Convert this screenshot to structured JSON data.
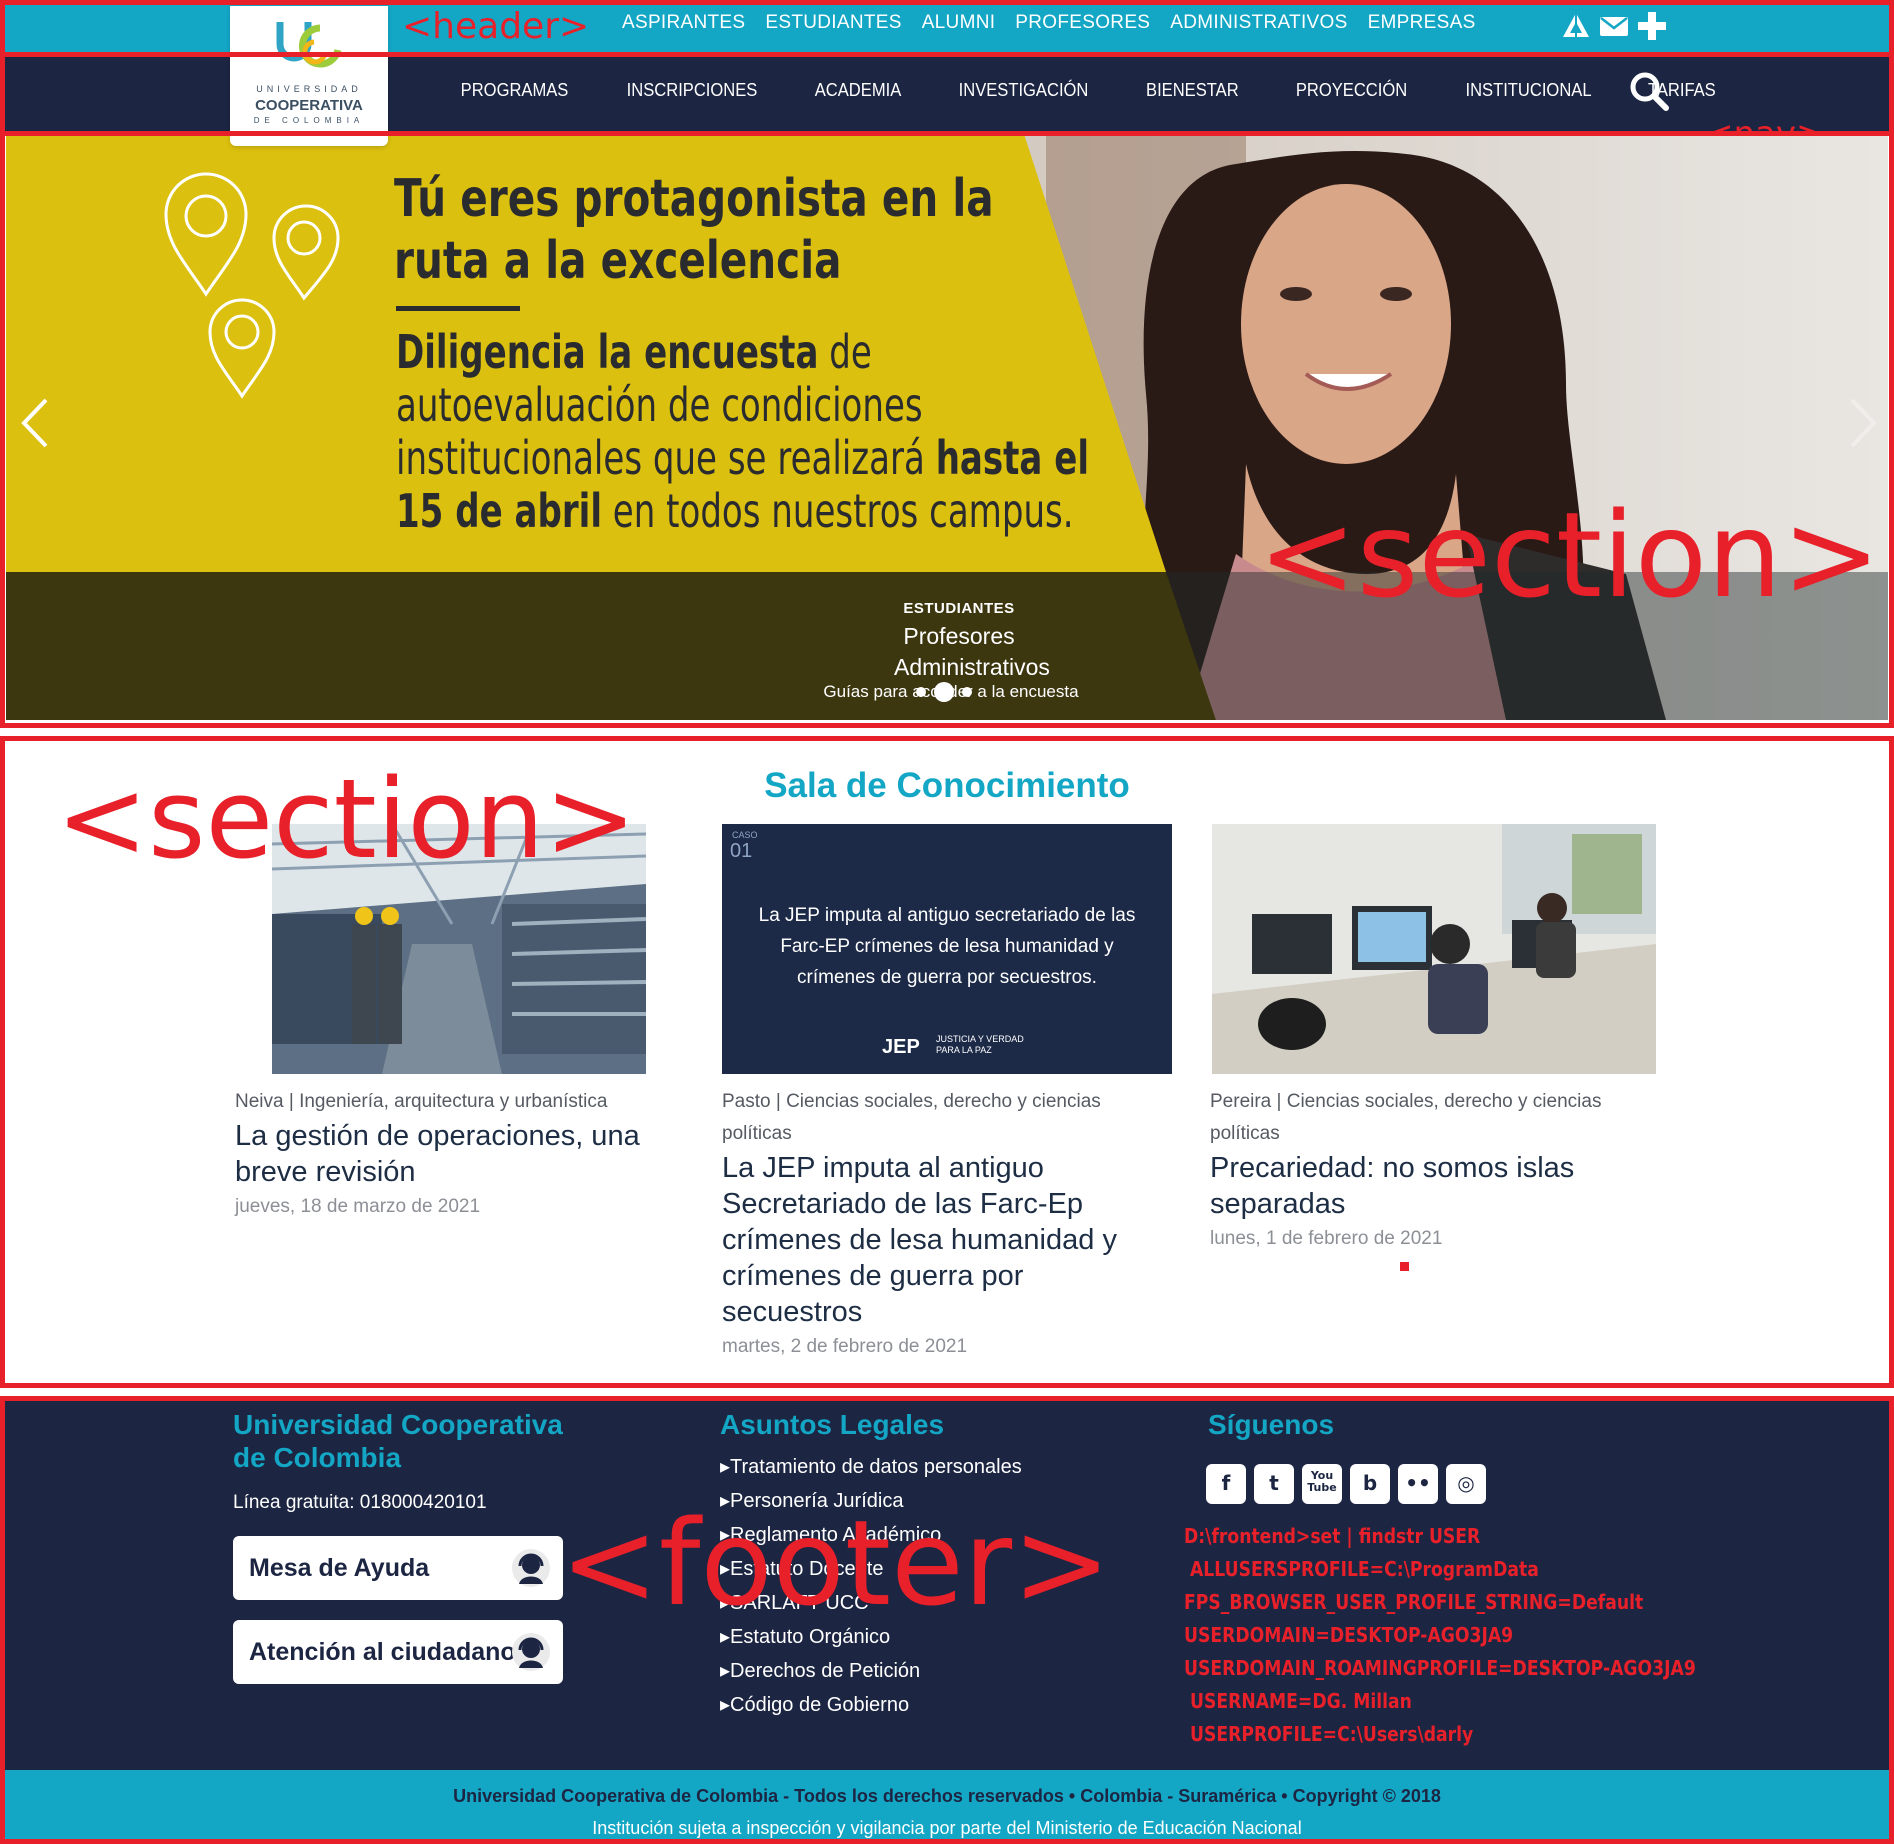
{
  "colors": {
    "accent": "#13a6c5",
    "navy": "#1c2542",
    "hero_yellow": "#dcc00f",
    "annotation_red": "#e8202a"
  },
  "logo": {
    "line1": "UNIVERSIDAD",
    "line2": "COOPERATIVA",
    "line3": "DE COLOMBIA"
  },
  "annotations": {
    "header": "<header>",
    "nav": "<nav>",
    "hero_section": "<section>",
    "knowledge_section": "<section>",
    "footer": "<footer>"
  },
  "top_nav": {
    "links": [
      "ASPIRANTES",
      "ESTUDIANTES",
      "ALUMNI",
      "PROFESORES",
      "ADMINISTRATIVOS",
      "EMPRESAS"
    ],
    "icons": [
      "network-icon",
      "mail-icon",
      "plus-icon"
    ]
  },
  "main_nav": {
    "items": [
      "PROGRAMAS",
      "INSCRIPCIONES",
      "ACADEMIA",
      "INVESTIGACIÓN",
      "BIENESTAR",
      "PROYECCIÓN",
      "INSTITUCIONAL",
      "TARIFAS"
    ],
    "search_icon": "search-icon"
  },
  "hero": {
    "headline_1": "Tú eres protagonista en la",
    "headline_2": "ruta a la excelencia",
    "body_bold_1": "Diligencia la encuesta",
    "body_1": " de",
    "body_2": "autoevaluación de condiciones",
    "body_3a": "institucionales que se realizará ",
    "body_3b": "hasta el",
    "body_4a": "15 de abril",
    "body_4b": " en todos nuestros campus.",
    "audience_1": "ESTUDIANTES",
    "audience_2": "Profesores",
    "audience_3": "Administrativos",
    "guide": "Guías para acceder a la encuesta",
    "slide_count": 3,
    "active_slide": 2
  },
  "knowledge": {
    "title": "Sala de Conocimiento",
    "cards": [
      {
        "meta": "Neiva | Ingeniería, arquitectura y urbanística",
        "title": "La gestión de operaciones, una breve revisión",
        "date": "jueves, 18 de marzo de 2021"
      },
      {
        "meta": "Pasto | Ciencias sociales, derecho y ciencias políticas",
        "title": "La JEP imputa al antiguo Secretariado de las Farc-Ep crímenes de lesa humanidad y crímenes de guerra por secuestros",
        "date": "martes, 2 de febrero de 2021",
        "image_text": "La JEP imputa al antiguo secretariado de las Farc-EP crímenes de lesa humanidad y crímenes de guerra por secuestros.",
        "image_badge_1": "CASO",
        "image_badge_2": "01",
        "image_logo": "JEP",
        "image_logo_sub_1": "JUSTICIA Y VERDAD",
        "image_logo_sub_2": "PARA LA PAZ"
      },
      {
        "meta": "Pereira | Ciencias sociales, derecho y ciencias políticas",
        "title": "Precariedad: no somos islas separadas",
        "date": "lunes, 1 de febrero de 2021"
      }
    ]
  },
  "footer": {
    "col1_title_1": "Universidad Cooperativa",
    "col1_title_2": "de Colombia",
    "phone": "Línea gratuita: 018000420101",
    "help_button": "Mesa de Ayuda",
    "citizen_button": "Atención al ciudadano",
    "col2_title": "Asuntos Legales",
    "legal_links": [
      "Tratamiento de datos personales",
      "Personería Jurídica",
      "Reglamento Académico",
      "Estatuto Docente",
      "SARLAFT UCC",
      "Estatuto Orgánico",
      "Derechos de Petición",
      "Código de Gobierno"
    ],
    "col3_title": "Síguenos",
    "social_icons": [
      "facebook-icon",
      "twitter-icon",
      "youtube-icon",
      "issuu-icon",
      "flickr-icon",
      "instagram-icon"
    ],
    "social_glyphs": [
      "f",
      "t",
      "You Tube",
      "b",
      "••",
      "◎"
    ],
    "cmd_lines": [
      "D:\\frontend>set | findstr USER",
      " ALLUSERSPROFILE=C:\\ProgramData",
      "FPS_BROWSER_USER_PROFILE_STRING=Default",
      "USERDOMAIN=DESKTOP-AGO3JA9",
      "USERDOMAIN_ROAMINGPROFILE=DESKTOP-AGO3JA9",
      " USERNAME=DG. Millan",
      " USERPROFILE=C:\\Users\\darly"
    ],
    "copyright": "Universidad Cooperativa de Colombia - Todos los derechos reservados • Colombia - Suramérica • Copyright © 2018",
    "oversight": "Institución sujeta a inspección y vigilancia por parte del Ministerio de Educación Nacional"
  }
}
